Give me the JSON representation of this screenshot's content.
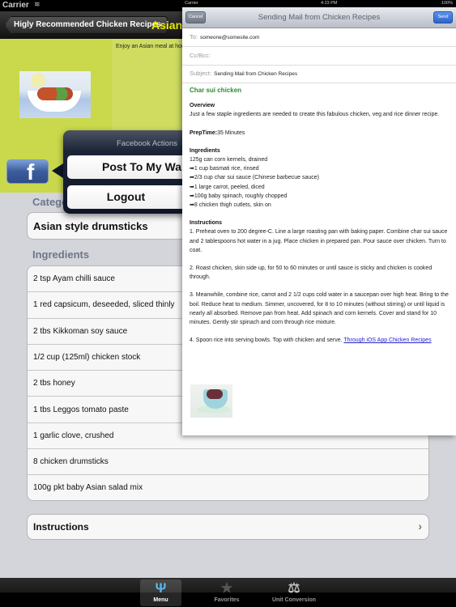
{
  "status_bar": {
    "carrier": "Carrier",
    "wifi_icon": "wifi-icon"
  },
  "nav": {
    "back_label": "Higly Recommended Chicken Recipes",
    "title": "Asian style drumsticks"
  },
  "header": {
    "description": "Enjoy an Asian meal at home"
  },
  "category": {
    "label": "Category",
    "value": "Asian style drumsticks"
  },
  "ingredients": {
    "label": "Ingredients",
    "items": [
      "2 tsp Ayam chilli sauce",
      "1 red capsicum, deseeded, sliced thinly",
      "2 tbs Kikkoman soy sauce",
      "1/2 cup (125ml) chicken stock",
      "2 tbs honey",
      "1 tbs Leggos tomato paste",
      "1 garlic clove, crushed",
      "8 chicken drumsticks",
      "100g pkt baby Asian salad mix"
    ]
  },
  "instructions_row": {
    "label": "Instructions",
    "chevron": "›"
  },
  "tabbar": {
    "tabs": [
      {
        "label": "Menu",
        "icon": "Ψ",
        "active": true
      },
      {
        "label": "Favorites",
        "icon": "★",
        "active": false
      },
      {
        "label": "Unit Conversion",
        "icon": "⚖",
        "active": false
      }
    ]
  },
  "facebook_popover": {
    "title": "Facebook Actions",
    "post_label": "Post To My Wall",
    "logout_label": "Logout",
    "fb_glyph": "f"
  },
  "mail": {
    "status": {
      "carrier": "Carrier",
      "time": "4:23 PM",
      "battery": "100%"
    },
    "cancel_label": "Cancel",
    "title": "Sending Mail from Chicken Recipes",
    "send_label": "Send",
    "to_label": "To:",
    "to_value": "someone@somesite.com",
    "cc_label": "Cc/Bcc:",
    "subject_label": "Subject:",
    "subject_value": "Sending Mail from Chicken Recipes",
    "body": {
      "recipe_title": "Char sui chicken",
      "overview_heading": "Overview",
      "overview_text": "Just a few staple ingredients are needed to create this fabulous chicken, veg and rice dinner recipe.",
      "preptime_label": "PrepTime:",
      "preptime_value": "35 Minutes",
      "ingredients_heading": "Ingredients",
      "ingredients": [
        "125g can corn kernels, drained",
        "➡1 cup basmati rice, rinsed",
        "➡2/3 cup char sui sauce (Chinese barbecue sauce)",
        "➡1 large carrot, peeled, diced",
        "➡100g baby spinach, roughly chopped",
        "➡8 chicken thigh cutlets, skin on"
      ],
      "instructions_heading": "Instructions",
      "steps": [
        "1. Preheat oven to 200 degree-C. Line a large roasting pan with baking paper. Combine char sui sauce and 2 tablespoons hot water in a jug. Place chicken in prepared pan. Pour sauce over chicken. Turn to coat.",
        "2. Roast chicken, skin side up, for 50 to 60 minutes or until sauce is sticky and chicken is cooked through.",
        "3. Meanwhile, combine rice, carrot and 2 1/2 cups cold water in a saucepan over high heat. Bring to the boil. Reduce heat to medium. Simmer, uncovered, for 8 to 10 minutes (without stirring) or until liquid is nearly all absorbed. Remove pan from heat. Add spinach and corn kernels. Cover and stand for 10 minutes. Gently stir spinach and corn through rice mixture.",
        "4. Spoon rice into serving bowls. Top with chicken and serve. "
      ],
      "link_text": "Through iOS App Chicken Recipes"
    }
  }
}
